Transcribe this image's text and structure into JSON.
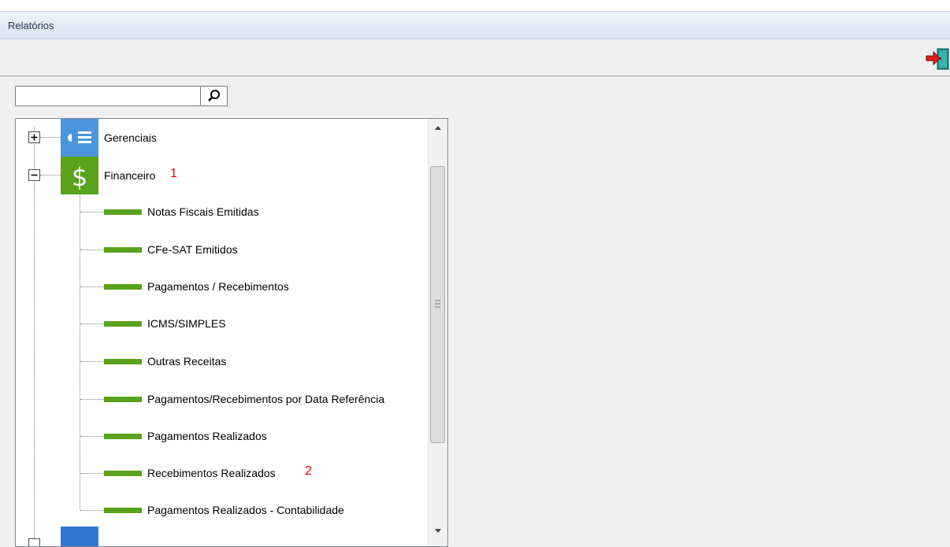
{
  "window": {
    "title": "Relatórios"
  },
  "toolbar": {
    "exit_icon": "exit-door-icon"
  },
  "search": {
    "value": "",
    "placeholder": "",
    "icon": "magnifier-icon"
  },
  "tree": {
    "categories": [
      {
        "label": "Gerenciais",
        "icon": "report-list-icon",
        "expanded": false
      },
      {
        "label": "Financeiro",
        "icon": "dollar-icon",
        "expanded": true,
        "marker": "1"
      }
    ],
    "items": [
      {
        "label": "Notas Fiscais Emitidas",
        "marker": ""
      },
      {
        "label": "CFe-SAT Emitidos",
        "marker": ""
      },
      {
        "label": "Pagamentos / Recebimentos",
        "marker": ""
      },
      {
        "label": "ICMS/SIMPLES",
        "marker": ""
      },
      {
        "label": "Outras Receitas",
        "marker": ""
      },
      {
        "label": "Pagamentos/Recebimentos por Data Referência",
        "marker": ""
      },
      {
        "label": "Pagamentos Realizados",
        "marker": ""
      },
      {
        "label": "Recebimentos Realizados",
        "marker": "2"
      },
      {
        "label": "Pagamentos Realizados - Contabilidade",
        "marker": ""
      }
    ]
  },
  "colors": {
    "item_bar": "#5aa21c",
    "gerenciais_icon_bg": "#4a96dc",
    "financeiro_icon_bg": "#5aa21c",
    "marker": "#e00000"
  }
}
